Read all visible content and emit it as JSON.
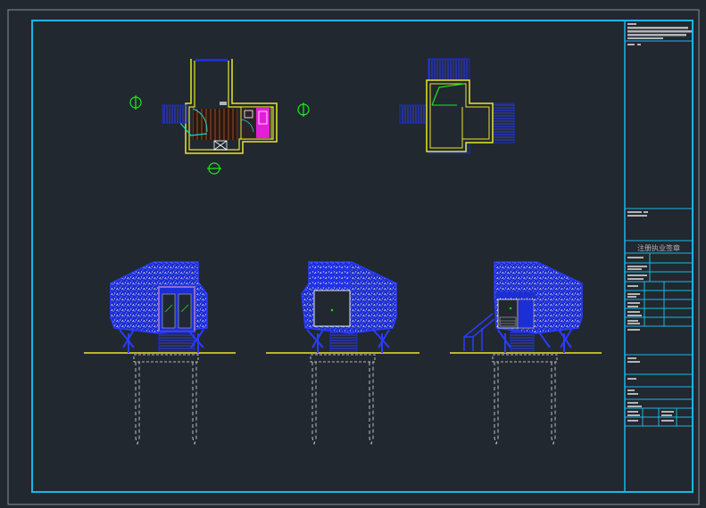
{
  "drawing": {
    "colors": {
      "background": "#212830",
      "frame": "#19b7e6",
      "wall": "#e9e629",
      "blue": "#1c2ed6",
      "green": "#16f016",
      "cyan": "#17d4d4",
      "magenta": "#e21fd7",
      "grey": "#b4b4b4",
      "brown": "#7a3a22",
      "white": "#e4e4e4",
      "purple": "#8a6cd1"
    },
    "title_block": {
      "stamp_label": "注册执业签章"
    }
  }
}
